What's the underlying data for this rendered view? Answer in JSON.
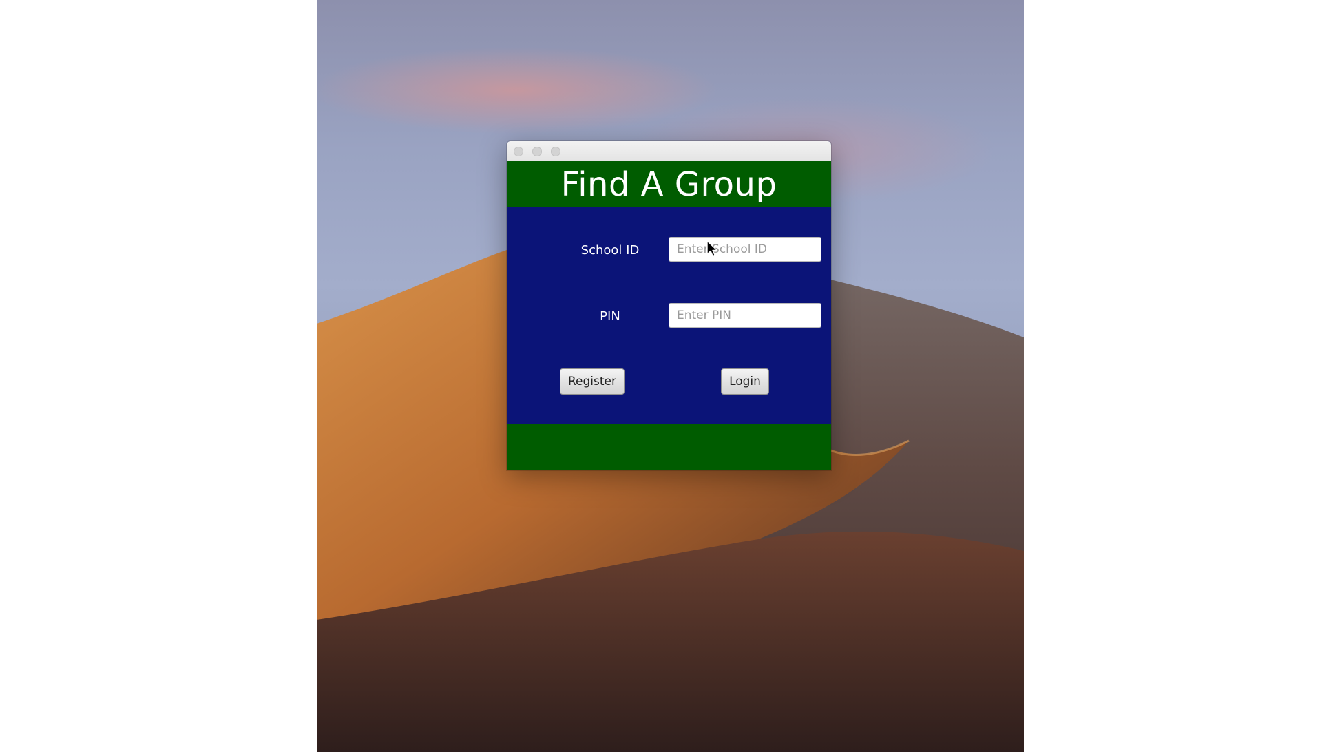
{
  "app": {
    "title": "Find A Group"
  },
  "form": {
    "school_id_label": "School ID",
    "school_id_value": "",
    "school_id_placeholder": "Enter School ID",
    "pin_label": "PIN",
    "pin_value": "",
    "pin_placeholder": "Enter PIN"
  },
  "buttons": {
    "register": "Register",
    "login": "Login"
  },
  "colors": {
    "header_band": "#005c00",
    "body_background": "#0b1478",
    "footer_band": "#005c00",
    "label_text": "#ffffff"
  },
  "icons": {
    "window_controls": [
      "close-icon",
      "minimize-icon",
      "zoom-icon"
    ],
    "pointer": "mouse-cursor-icon"
  }
}
